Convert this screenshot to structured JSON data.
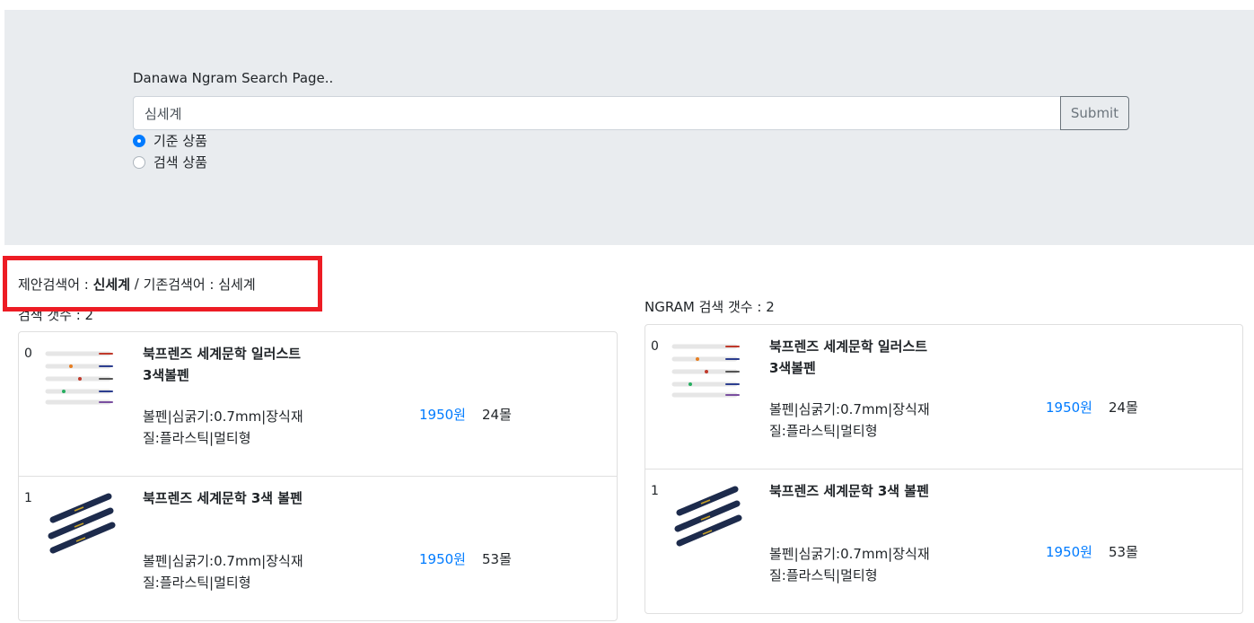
{
  "header": {
    "title": "Danawa Ngram Search Page..",
    "search_value": "심세계",
    "submit_label": "Submit",
    "radios": [
      {
        "label": "기준 상품",
        "checked": true
      },
      {
        "label": "검색 상품",
        "checked": false
      }
    ]
  },
  "suggestion": {
    "suggest_prefix": "제안검색어 : ",
    "suggest_word": "신세계",
    "separator": " / ",
    "original_prefix": "기존검색어 : ",
    "original_word": "심세계"
  },
  "left": {
    "count_label": "검색 갯수 : 2",
    "items": [
      {
        "index": "0",
        "name": "북프렌즈 세계문학 일러스트 3색볼펜",
        "desc": "볼펜|심굵기:0.7mm|장식재질:플라스틱|멀티형",
        "price": "1950원",
        "mall": "24몰",
        "thumb": "white-pens-icon"
      },
      {
        "index": "1",
        "name": "북프렌즈 세계문학 3색 볼펜",
        "desc": "볼펜|심굵기:0.7mm|장식재질:플라스틱|멀티형",
        "price": "1950원",
        "mall": "53몰",
        "thumb": "navy-pens-icon"
      }
    ]
  },
  "right": {
    "count_label": "NGRAM 검색 갯수 : 2",
    "items": [
      {
        "index": "0",
        "name": "북프렌즈 세계문학 일러스트 3색볼펜",
        "desc": "볼펜|심굵기:0.7mm|장식재질:플라스틱|멀티형",
        "price": "1950원",
        "mall": "24몰",
        "thumb": "white-pens-icon"
      },
      {
        "index": "1",
        "name": "북프렌즈 세계문학 3색 볼펜",
        "desc": "볼펜|심굵기:0.7mm|장식재질:플라스틱|멀티형",
        "price": "1950원",
        "mall": "53몰",
        "thumb": "navy-pens-icon"
      }
    ]
  },
  "colors": {
    "accent": "#007bff",
    "highlight_border": "#ed1c24",
    "jumbotron": "#e9ecef"
  }
}
